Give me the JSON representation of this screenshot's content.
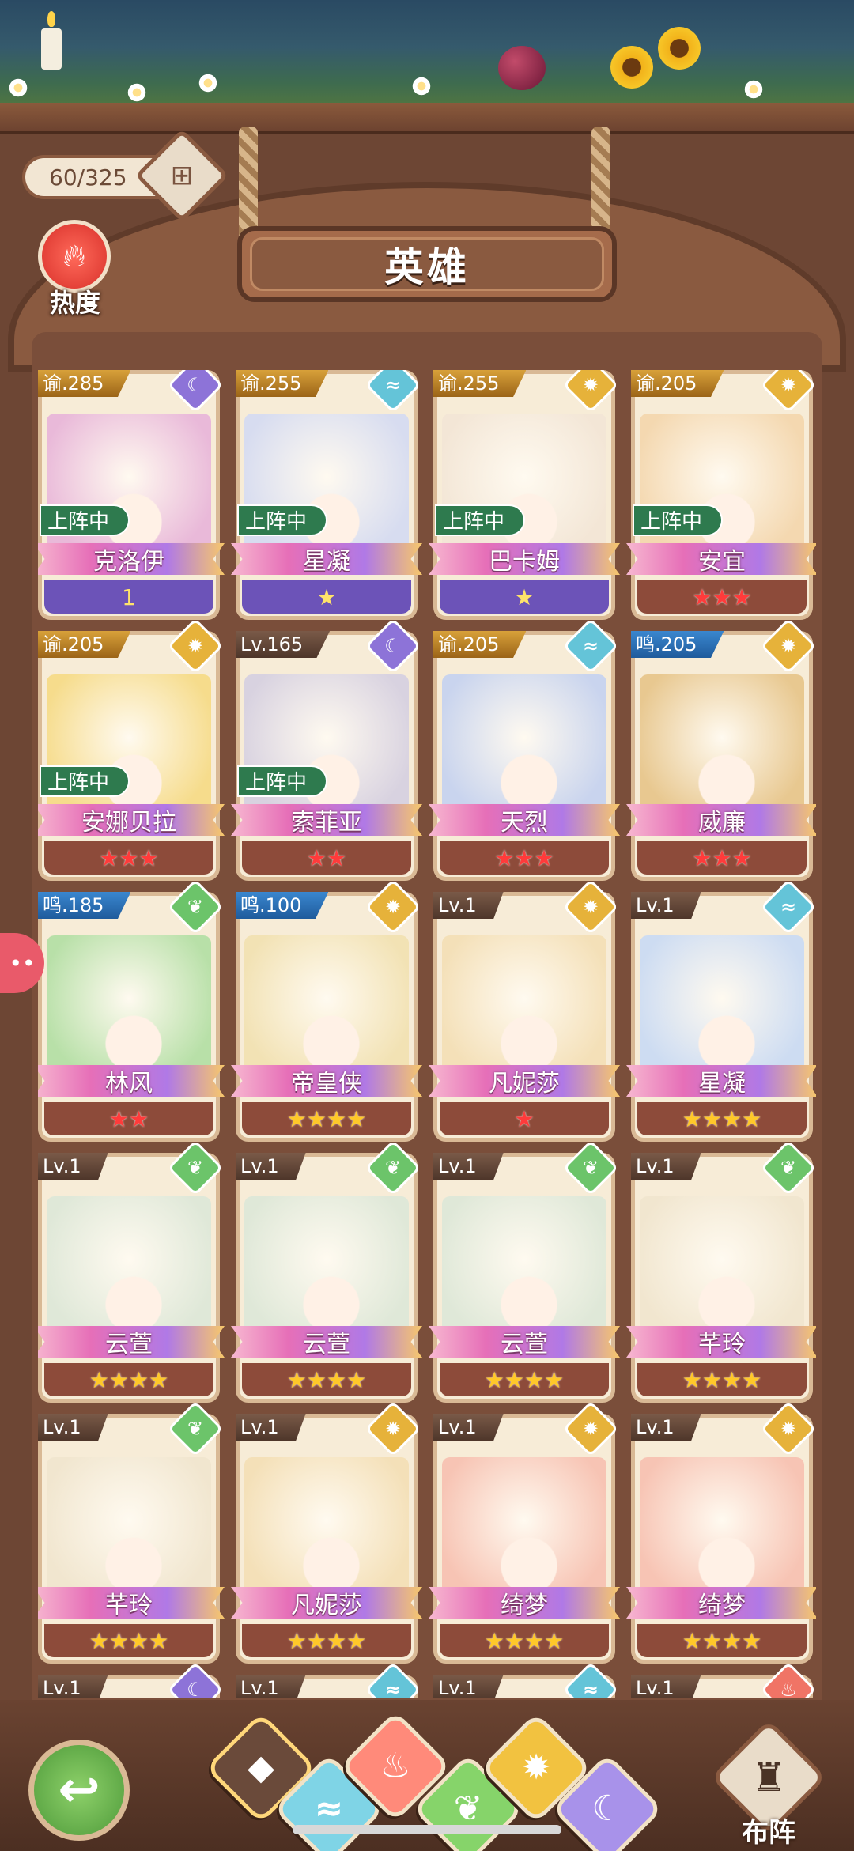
{
  "header": {
    "counter": "60/325",
    "hot_label": "热度",
    "title": "英雄"
  },
  "cards": [
    {
      "level": "谕.285",
      "level_style": "gold",
      "element": "moon",
      "element_glyph": "☾",
      "deployed": true,
      "name": "克洛伊",
      "rank_type": "purple",
      "rank": "1",
      "art": "#e9b9d9"
    },
    {
      "level": "谕.255",
      "level_style": "gold",
      "element": "wind",
      "element_glyph": "≈",
      "deployed": true,
      "name": "星凝",
      "rank_type": "purple",
      "rank": "★",
      "art": "#d7dcf0"
    },
    {
      "level": "谕.255",
      "level_style": "gold",
      "element": "sun",
      "element_glyph": "✹",
      "deployed": true,
      "name": "巴卡姆",
      "rank_type": "purple",
      "rank": "★",
      "art": "#f3e6d6"
    },
    {
      "level": "谕.205",
      "level_style": "gold",
      "element": "sun",
      "element_glyph": "✹",
      "deployed": true,
      "name": "安宜",
      "rank_type": "red",
      "rank": "★★★",
      "art": "#f4d8b0"
    },
    {
      "level": "谕.205",
      "level_style": "gold",
      "element": "sun",
      "element_glyph": "✹",
      "deployed": true,
      "name": "安娜贝拉",
      "rank_type": "red",
      "rank": "★★★",
      "art": "#f6dc8c"
    },
    {
      "level": "Lv.165",
      "level_style": "brown",
      "element": "moon",
      "element_glyph": "☾",
      "deployed": true,
      "name": "索菲亚",
      "rank_type": "red",
      "rank": "★★",
      "art": "#d8d2e0"
    },
    {
      "level": "谕.205",
      "level_style": "gold",
      "element": "wind",
      "element_glyph": "≈",
      "deployed": false,
      "name": "天烈",
      "rank_type": "red",
      "rank": "★★★",
      "art": "#c9d4ee"
    },
    {
      "level": "鸣.205",
      "level_style": "blue",
      "element": "sun",
      "element_glyph": "✹",
      "deployed": false,
      "name": "威廉",
      "rank_type": "red",
      "rank": "★★★",
      "art": "#e8c890"
    },
    {
      "level": "鸣.185",
      "level_style": "blue",
      "element": "leaf",
      "element_glyph": "❦",
      "deployed": false,
      "name": "林风",
      "rank_type": "red",
      "rank": "★★",
      "art": "#b8e0a8"
    },
    {
      "level": "鸣.100",
      "level_style": "blue",
      "element": "sun",
      "element_glyph": "✹",
      "deployed": false,
      "name": "帝皇侠",
      "rank_type": "gold",
      "rank": "★★★★",
      "art": "#f2e2b4"
    },
    {
      "level": "Lv.1",
      "level_style": "brown",
      "element": "sun",
      "element_glyph": "✹",
      "deployed": false,
      "name": "凡妮莎",
      "rank_type": "red",
      "rank": "★",
      "art": "#f4e0b8"
    },
    {
      "level": "Lv.1",
      "level_style": "brown",
      "element": "wind",
      "element_glyph": "≈",
      "deployed": false,
      "name": "星凝",
      "rank_type": "gold",
      "rank": "★★★★",
      "art": "#cddcf2"
    },
    {
      "level": "Lv.1",
      "level_style": "brown",
      "element": "leaf",
      "element_glyph": "❦",
      "deployed": false,
      "name": "云萱",
      "rank_type": "gold",
      "rank": "★★★★",
      "art": "#dfe8d8"
    },
    {
      "level": "Lv.1",
      "level_style": "brown",
      "element": "leaf",
      "element_glyph": "❦",
      "deployed": false,
      "name": "云萱",
      "rank_type": "gold",
      "rank": "★★★★",
      "art": "#dfe8d8"
    },
    {
      "level": "Lv.1",
      "level_style": "brown",
      "element": "leaf",
      "element_glyph": "❦",
      "deployed": false,
      "name": "云萱",
      "rank_type": "gold",
      "rank": "★★★★",
      "art": "#dfe8d8"
    },
    {
      "level": "Lv.1",
      "level_style": "brown",
      "element": "leaf",
      "element_glyph": "❦",
      "deployed": false,
      "name": "芊玲",
      "rank_type": "gold",
      "rank": "★★★★",
      "art": "#f1e6cf"
    },
    {
      "level": "Lv.1",
      "level_style": "brown",
      "element": "leaf",
      "element_glyph": "❦",
      "deployed": false,
      "name": "芊玲",
      "rank_type": "gold",
      "rank": "★★★★",
      "art": "#f1e6cf"
    },
    {
      "level": "Lv.1",
      "level_style": "brown",
      "element": "sun",
      "element_glyph": "✹",
      "deployed": false,
      "name": "凡妮莎",
      "rank_type": "gold",
      "rank": "★★★★",
      "art": "#f4e0b8"
    },
    {
      "level": "Lv.1",
      "level_style": "brown",
      "element": "sun",
      "element_glyph": "✹",
      "deployed": false,
      "name": "绮梦",
      "rank_type": "gold",
      "rank": "★★★★",
      "art": "#f7c4b4"
    },
    {
      "level": "Lv.1",
      "level_style": "brown",
      "element": "sun",
      "element_glyph": "✹",
      "deployed": false,
      "name": "绮梦",
      "rank_type": "gold",
      "rank": "★★★★",
      "art": "#f7c4b4"
    }
  ],
  "deployed_label": "上阵中",
  "peek_cards": [
    {
      "level": "Lv.1",
      "element": "moon",
      "element_glyph": "☾"
    },
    {
      "level": "Lv.1",
      "element": "wind",
      "element_glyph": "≈"
    },
    {
      "level": "Lv.1",
      "element": "wind",
      "element_glyph": "≈"
    },
    {
      "level": "Lv.1",
      "element": "fire",
      "element_glyph": "♨"
    }
  ],
  "bottom": {
    "back_icon": "↩",
    "tabs": [
      {
        "id": "all",
        "glyph": "◆"
      },
      {
        "id": "fire",
        "glyph": "♨"
      },
      {
        "id": "wind",
        "glyph": "≈"
      },
      {
        "id": "sun",
        "glyph": "✹"
      },
      {
        "id": "leaf",
        "glyph": "❦"
      },
      {
        "id": "moon",
        "glyph": "☾"
      }
    ],
    "formation_icon": "♜",
    "formation_label": "布阵"
  }
}
